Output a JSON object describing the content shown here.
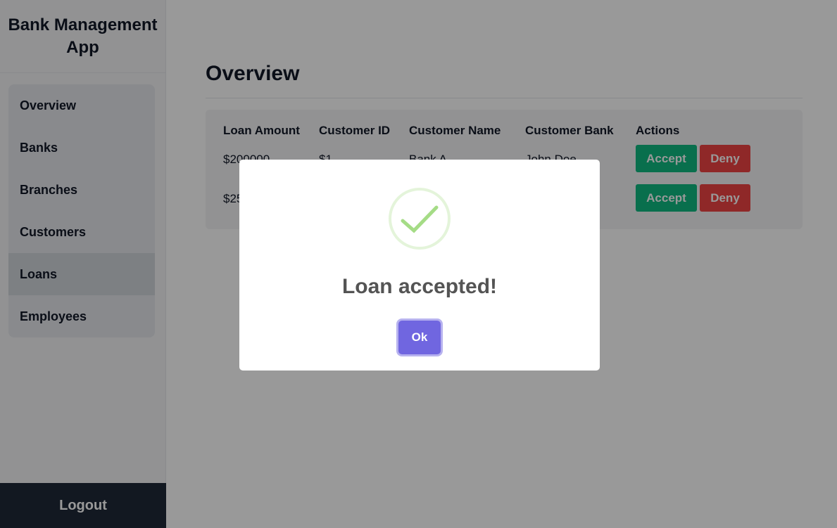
{
  "app": {
    "title": "Bank Management App"
  },
  "sidebar": {
    "items": [
      {
        "label": "Overview"
      },
      {
        "label": "Banks"
      },
      {
        "label": "Branches"
      },
      {
        "label": "Customers"
      },
      {
        "label": "Loans",
        "active": true
      },
      {
        "label": "Employees"
      }
    ],
    "logout_label": "Logout"
  },
  "main": {
    "title": "Overview",
    "table": {
      "headers": [
        "Loan Amount",
        "Customer ID",
        "Customer Name",
        "Customer Bank",
        "Actions"
      ],
      "rows": [
        {
          "loan_amount": "$200000",
          "customer_id": "$1",
          "customer_name": "Bank A",
          "customer_bank": "John Doe",
          "accept_label": "Accept",
          "deny_label": "Deny"
        },
        {
          "loan_amount": "$25",
          "customer_id": "",
          "customer_name": "",
          "customer_bank": "",
          "accept_label": "Accept",
          "deny_label": "Deny"
        }
      ]
    }
  },
  "modal": {
    "icon": "success-check-icon",
    "title": "Loan accepted!",
    "ok_label": "Ok"
  },
  "colors": {
    "accept": "#10b981",
    "deny": "#ef4444",
    "ok": "#7066e0",
    "success": "#a5dc86",
    "sidebar_dark": "#1f2937"
  }
}
